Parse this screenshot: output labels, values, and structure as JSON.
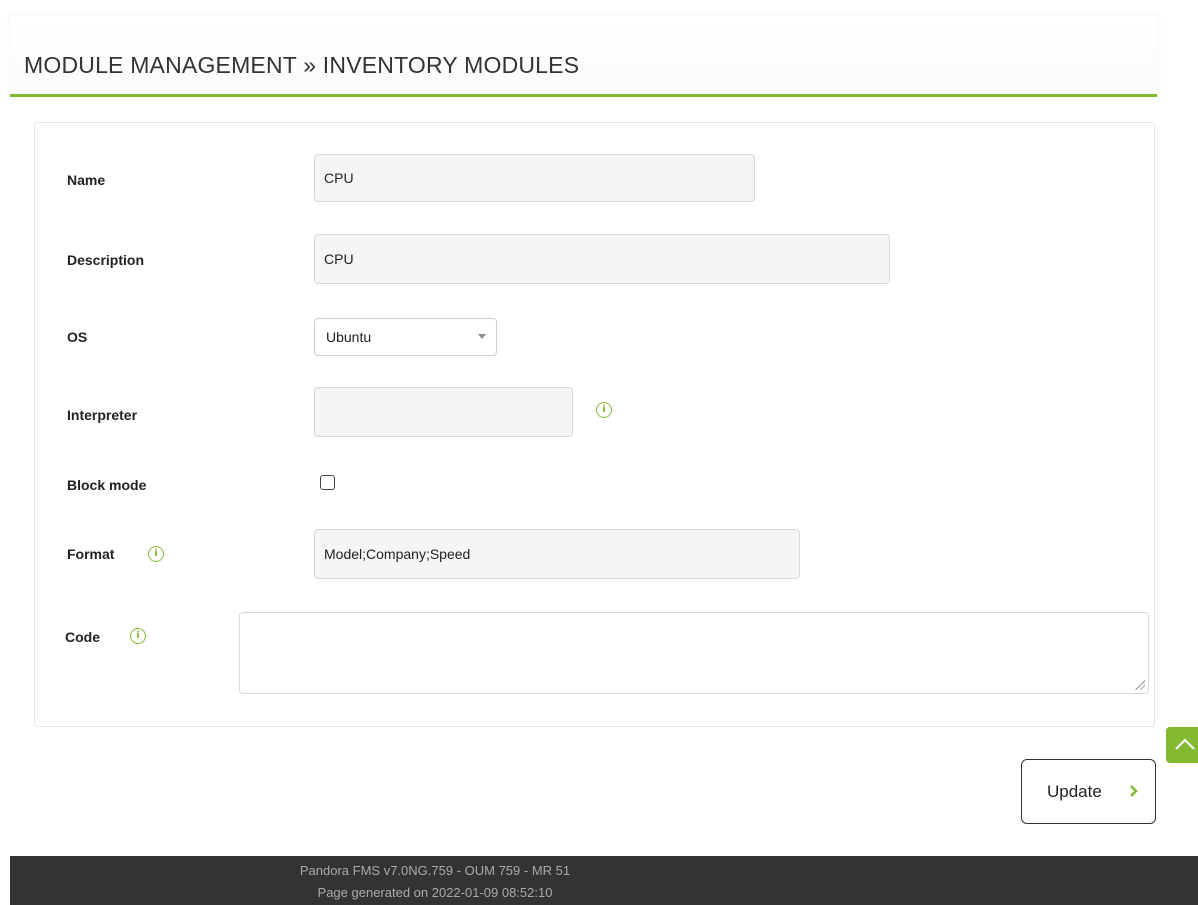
{
  "page": {
    "title": "MODULE MANAGEMENT » INVENTORY MODULES"
  },
  "form": {
    "name": {
      "label": "Name",
      "value": "CPU"
    },
    "description": {
      "label": "Description",
      "value": "CPU"
    },
    "os": {
      "label": "OS",
      "selected": "Ubuntu"
    },
    "interpreter": {
      "label": "Interpreter",
      "value": "",
      "info_icon": "info-icon"
    },
    "block_mode": {
      "label": "Block mode",
      "checked": false
    },
    "format": {
      "label": "Format",
      "value": "Model;Company;Speed",
      "info_icon": "info-icon"
    },
    "code": {
      "label": "Code",
      "value": "",
      "info_icon": "info-icon"
    }
  },
  "actions": {
    "update_label": "Update",
    "update_icon": "chevron-right-icon",
    "scroll_top_icon": "chevron-up-icon"
  },
  "footer": {
    "version": "Pandora FMS v7.0NG.759 - OUM 759 - MR 51",
    "generated": "Page generated on 2022-01-09 08:52:10"
  },
  "colors": {
    "accent": "#82b92e",
    "footer_bg": "#333333",
    "footer_text": "#aaaaaa"
  }
}
